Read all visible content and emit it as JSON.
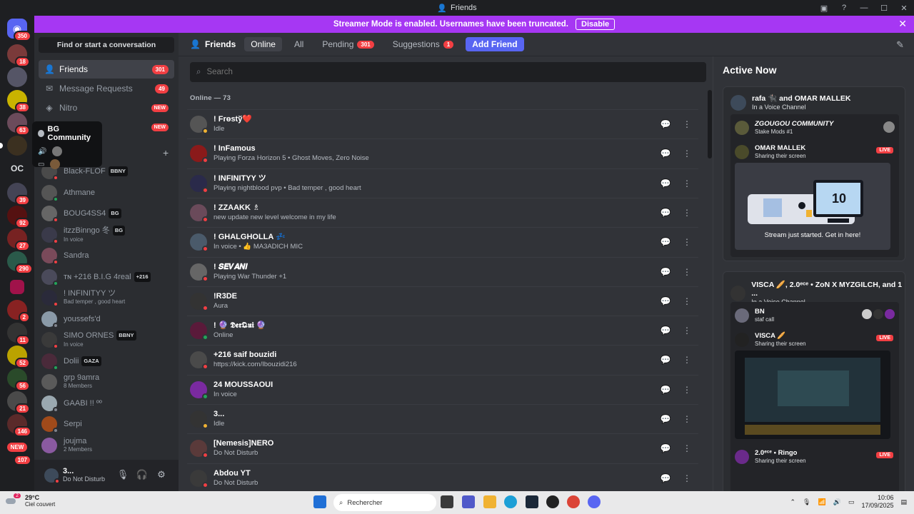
{
  "window": {
    "title": "Friends"
  },
  "banner": {
    "text": "Streamer Mode is enabled. Usernames have been truncated.",
    "disable_label": "Disable"
  },
  "rail": {
    "top_badge": "350",
    "badges": [
      "18",
      "38",
      "63",
      "39",
      "92",
      "27",
      "290",
      "2",
      "11",
      "52",
      "56",
      "21",
      "146",
      "107"
    ],
    "oc_label": "OC",
    "new_label": "NEW"
  },
  "sidebar": {
    "find_label": "Find or start a conversation",
    "nav": [
      {
        "label": "Friends",
        "count": "301"
      },
      {
        "label": "Message Requests",
        "count": "49"
      },
      {
        "label": "Nitro",
        "badge": "NEW"
      },
      {
        "label": "",
        "badge": "NEW"
      }
    ],
    "popup": {
      "title": "BG Community"
    },
    "dms": [
      {
        "name": "Black-FLOF",
        "tag": "BBNY",
        "sub": ""
      },
      {
        "name": "Athmane",
        "tag": "",
        "sub": ""
      },
      {
        "name": "BOUG4SS4",
        "tag": "BG",
        "sub": ""
      },
      {
        "name": "itzzBinngo 冬",
        "tag": "BG",
        "sub": "In voice"
      },
      {
        "name": "Sandra",
        "tag": "",
        "sub": ""
      },
      {
        "name": "ᴛɴ +216 B.I.G 4real",
        "tag": "+216",
        "sub": ""
      },
      {
        "name": "! INFINITYY ツ",
        "tag": "",
        "sub": "Bad temper , good heart"
      },
      {
        "name": "youssefs'd",
        "tag": "",
        "sub": ""
      },
      {
        "name": "SIMO ORNES",
        "tag": "BBNY",
        "sub": "In voice"
      },
      {
        "name": "Dolii",
        "tag": "GAZA",
        "sub": ""
      },
      {
        "name": "grp 9amra",
        "tag": "",
        "sub": "8 Members"
      },
      {
        "name": "GAABI !! ºº",
        "tag": "",
        "sub": ""
      },
      {
        "name": "Serpi",
        "tag": "",
        "sub": ""
      },
      {
        "name": "joujma",
        "tag": "",
        "sub": "2 Members"
      }
    ]
  },
  "user": {
    "name": "3...",
    "status": "Do Not Disturb"
  },
  "main": {
    "friends_label": "Friends",
    "tabs": [
      {
        "label": "Online"
      },
      {
        "label": "All"
      },
      {
        "label": "Pending",
        "count": "301"
      },
      {
        "label": "Suggestions",
        "count": "1"
      }
    ],
    "add_friend_label": "Add Friend",
    "search_placeholder": "Search",
    "online_header": "Online — 73",
    "friends": [
      {
        "name": "! Frөstў❤️",
        "sub": "Idle",
        "status": "idle"
      },
      {
        "name": "! InFamous",
        "sub": "Playing Forza Horizon 5 • Ghost Moves, Zero Noise",
        "status": "dnd"
      },
      {
        "name": "! INFINITYY ツ",
        "sub": "Playing nightblood pvp • Bad temper , good heart",
        "status": "dnd"
      },
      {
        "name": "! ZZAAKK ♗",
        "sub": "new update new level welcome in my life",
        "status": "dnd"
      },
      {
        "name": "! GHALGHOLLA 💤",
        "sub": "In voice • 👍 MA3ADICH MIC",
        "status": "dnd"
      },
      {
        "name": "! 𝑺𝑬𝑽𝑨𝑵𝑰",
        "sub": "Playing War Thunder +1",
        "status": "dnd"
      },
      {
        "name": "!R3DE",
        "sub": "Aura",
        "status": "dnd"
      },
      {
        "name": "! 🔮 𝕯𝖊𝖗𝕼𝖚𝖎 🔮",
        "sub": "Online",
        "status": "online"
      },
      {
        "name": "+216 saif bouzidi",
        "sub": "https://kick.com/Ibouzidi216",
        "status": "dnd"
      },
      {
        "name": "24 MOUSSAOUI",
        "sub": "In voice",
        "status": "online"
      },
      {
        "name": "3...",
        "sub": "Idle",
        "status": "idle"
      },
      {
        "name": "[Nemesis]NERO",
        "sub": "Do Not Disturb",
        "status": "dnd"
      },
      {
        "name": "Abdou YT",
        "sub": "Do Not Disturb",
        "status": "dnd"
      }
    ]
  },
  "active_now": {
    "title": "Active Now",
    "card1": {
      "title": "rafa 🐈‍⬛ and OMAR MALLEK",
      "subtitle": "In a Voice Channel",
      "server": "ZGOUGOU COMMUNITY",
      "channel": "Stake Mods #1",
      "streamer": "OMAR MALLEK",
      "streamer_sub": "Sharing their screen",
      "live": "LIVE",
      "preview_number": "10",
      "preview_caption": "Stream just started. Get in here!"
    },
    "card2": {
      "title": "VISCA 🥖, 2.0ᵉᶜᵉ • ZoN X MYZGILCH, and 1 ...",
      "subtitle": "In a Voice Channel",
      "row1_name": "BN",
      "row1_sub": "staf call",
      "row2_name": "VISCA 🥖",
      "row2_sub": "Sharing their screen",
      "row3_name": "2.0ᵉᶜᵉ • Ringo",
      "row3_sub": "Sharing their screen",
      "live": "LIVE"
    }
  },
  "taskbar": {
    "temp": "29°C",
    "weather": "Ciel couvert",
    "weather_badge": "2",
    "search": "Rechercher",
    "time": "10:06",
    "date": "17/09/2025"
  },
  "colors": {
    "brand": "#5865f2",
    "streamer_banner": "#a637f3",
    "danger": "#f23f43",
    "online": "#23a55a",
    "idle": "#f0b232"
  }
}
